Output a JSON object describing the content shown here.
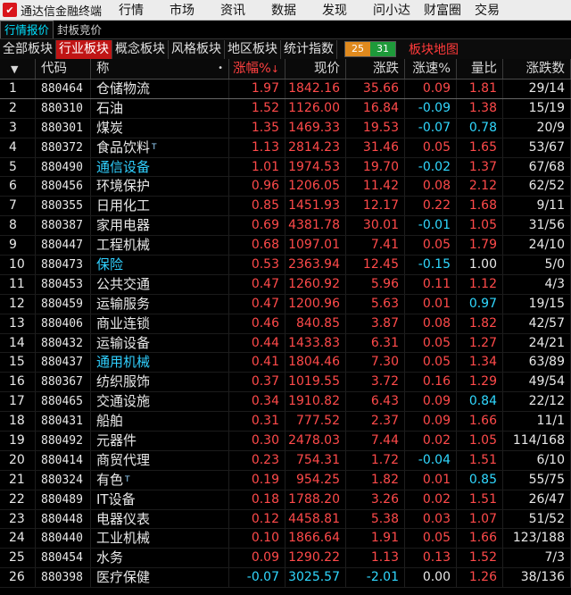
{
  "app": {
    "title": "通达信金融终端",
    "logo_glyph": "✔"
  },
  "menu": [
    "行情",
    "市场",
    "资讯",
    "数据",
    "发现",
    "问小达",
    "财富圈",
    "交易"
  ],
  "subtabs": [
    {
      "label": "行情报价",
      "active": true
    },
    {
      "label": "封板竞价",
      "active": false
    }
  ],
  "board_tabs": [
    {
      "label": "全部板块",
      "active": false
    },
    {
      "label": "行业板块",
      "active": true
    },
    {
      "label": "概念板块",
      "active": false
    },
    {
      "label": "风格板块",
      "active": false
    },
    {
      "label": "地区板块",
      "active": false
    },
    {
      "label": "统计指数",
      "active": false
    }
  ],
  "advance_decline": {
    "up": "25",
    "down": "31"
  },
  "map_link": "板块地图",
  "columns": {
    "code": "代码",
    "name": "称",
    "rise_pct": "涨幅%",
    "price": "现价",
    "change": "涨跌",
    "speed": "涨速%",
    "vol_ratio": "量比",
    "up_down": "涨跌数"
  },
  "colors": {
    "up": "#ff4a4a",
    "down": "#30d8ff",
    "active_tab": "#c01515",
    "cyan_name": "#30d0ff"
  },
  "rows": [
    {
      "i": "1",
      "code": "880464",
      "name": "仓储物流",
      "tag": "",
      "cyan": false,
      "pct": "1.97",
      "price": "1842.16",
      "chg": "35.66",
      "speed": "0.09",
      "speed_dir": "up",
      "vr": "1.81",
      "vr_dir": "up",
      "ud": "29/14"
    },
    {
      "i": "2",
      "code": "880310",
      "name": "石油",
      "tag": "",
      "cyan": false,
      "pct": "1.52",
      "price": "1126.00",
      "chg": "16.84",
      "speed": "-0.09",
      "speed_dir": "down",
      "vr": "1.38",
      "vr_dir": "up",
      "ud": "15/19"
    },
    {
      "i": "3",
      "code": "880301",
      "name": "煤炭",
      "tag": "",
      "cyan": false,
      "pct": "1.35",
      "price": "1469.33",
      "chg": "19.53",
      "speed": "-0.07",
      "speed_dir": "down",
      "vr": "0.78",
      "vr_dir": "down",
      "ud": "20/9"
    },
    {
      "i": "4",
      "code": "880372",
      "name": "食品饮料",
      "tag": "T",
      "cyan": false,
      "pct": "1.13",
      "price": "2814.23",
      "chg": "31.46",
      "speed": "0.05",
      "speed_dir": "up",
      "vr": "1.65",
      "vr_dir": "up",
      "ud": "53/67"
    },
    {
      "i": "5",
      "code": "880490",
      "name": "通信设备",
      "tag": "",
      "cyan": true,
      "pct": "1.01",
      "price": "1974.53",
      "chg": "19.70",
      "speed": "-0.02",
      "speed_dir": "down",
      "vr": "1.37",
      "vr_dir": "up",
      "ud": "67/68"
    },
    {
      "i": "6",
      "code": "880456",
      "name": "环境保护",
      "tag": "",
      "cyan": false,
      "pct": "0.96",
      "price": "1206.05",
      "chg": "11.42",
      "speed": "0.08",
      "speed_dir": "up",
      "vr": "2.12",
      "vr_dir": "up",
      "ud": "62/52"
    },
    {
      "i": "7",
      "code": "880355",
      "name": "日用化工",
      "tag": "",
      "cyan": false,
      "pct": "0.85",
      "price": "1451.93",
      "chg": "12.17",
      "speed": "0.22",
      "speed_dir": "up",
      "vr": "1.68",
      "vr_dir": "up",
      "ud": "9/11"
    },
    {
      "i": "8",
      "code": "880387",
      "name": "家用电器",
      "tag": "",
      "cyan": false,
      "pct": "0.69",
      "price": "4381.78",
      "chg": "30.01",
      "speed": "-0.01",
      "speed_dir": "down",
      "vr": "1.05",
      "vr_dir": "up",
      "ud": "31/56"
    },
    {
      "i": "9",
      "code": "880447",
      "name": "工程机械",
      "tag": "",
      "cyan": false,
      "pct": "0.68",
      "price": "1097.01",
      "chg": "7.41",
      "speed": "0.05",
      "speed_dir": "up",
      "vr": "1.79",
      "vr_dir": "up",
      "ud": "24/10"
    },
    {
      "i": "10",
      "code": "880473",
      "name": "保险",
      "tag": "",
      "cyan": true,
      "pct": "0.53",
      "price": "2363.94",
      "chg": "12.45",
      "speed": "-0.15",
      "speed_dir": "down",
      "vr": "1.00",
      "vr_dir": "flat",
      "ud": "5/0"
    },
    {
      "i": "11",
      "code": "880453",
      "name": "公共交通",
      "tag": "",
      "cyan": false,
      "pct": "0.47",
      "price": "1260.92",
      "chg": "5.96",
      "speed": "0.11",
      "speed_dir": "up",
      "vr": "1.12",
      "vr_dir": "up",
      "ud": "4/3"
    },
    {
      "i": "12",
      "code": "880459",
      "name": "运输服务",
      "tag": "",
      "cyan": false,
      "pct": "0.47",
      "price": "1200.96",
      "chg": "5.63",
      "speed": "0.01",
      "speed_dir": "up",
      "vr": "0.97",
      "vr_dir": "down",
      "ud": "19/15"
    },
    {
      "i": "13",
      "code": "880406",
      "name": "商业连锁",
      "tag": "",
      "cyan": false,
      "pct": "0.46",
      "price": "840.85",
      "chg": "3.87",
      "speed": "0.08",
      "speed_dir": "up",
      "vr": "1.82",
      "vr_dir": "up",
      "ud": "42/57"
    },
    {
      "i": "14",
      "code": "880432",
      "name": "运输设备",
      "tag": "",
      "cyan": false,
      "pct": "0.44",
      "price": "1433.83",
      "chg": "6.31",
      "speed": "0.05",
      "speed_dir": "up",
      "vr": "1.27",
      "vr_dir": "up",
      "ud": "24/21"
    },
    {
      "i": "15",
      "code": "880437",
      "name": "通用机械",
      "tag": "",
      "cyan": true,
      "pct": "0.41",
      "price": "1804.46",
      "chg": "7.30",
      "speed": "0.05",
      "speed_dir": "up",
      "vr": "1.34",
      "vr_dir": "up",
      "ud": "63/89"
    },
    {
      "i": "16",
      "code": "880367",
      "name": "纺织服饰",
      "tag": "",
      "cyan": false,
      "pct": "0.37",
      "price": "1019.55",
      "chg": "3.72",
      "speed": "0.16",
      "speed_dir": "up",
      "vr": "1.29",
      "vr_dir": "up",
      "ud": "49/54"
    },
    {
      "i": "17",
      "code": "880465",
      "name": "交通设施",
      "tag": "",
      "cyan": false,
      "pct": "0.34",
      "price": "1910.82",
      "chg": "6.43",
      "speed": "0.09",
      "speed_dir": "up",
      "vr": "0.84",
      "vr_dir": "down",
      "ud": "22/12"
    },
    {
      "i": "18",
      "code": "880431",
      "name": "船舶",
      "tag": "",
      "cyan": false,
      "pct": "0.31",
      "price": "777.52",
      "chg": "2.37",
      "speed": "0.09",
      "speed_dir": "up",
      "vr": "1.66",
      "vr_dir": "up",
      "ud": "11/1"
    },
    {
      "i": "19",
      "code": "880492",
      "name": "元器件",
      "tag": "",
      "cyan": false,
      "pct": "0.30",
      "price": "2478.03",
      "chg": "7.44",
      "speed": "0.02",
      "speed_dir": "up",
      "vr": "1.05",
      "vr_dir": "up",
      "ud": "114/168"
    },
    {
      "i": "20",
      "code": "880414",
      "name": "商贸代理",
      "tag": "",
      "cyan": false,
      "pct": "0.23",
      "price": "754.31",
      "chg": "1.72",
      "speed": "-0.04",
      "speed_dir": "down",
      "vr": "1.51",
      "vr_dir": "up",
      "ud": "6/10"
    },
    {
      "i": "21",
      "code": "880324",
      "name": "有色",
      "tag": "T",
      "cyan": false,
      "pct": "0.19",
      "price": "954.25",
      "chg": "1.82",
      "speed": "0.01",
      "speed_dir": "up",
      "vr": "0.85",
      "vr_dir": "down",
      "ud": "55/75"
    },
    {
      "i": "22",
      "code": "880489",
      "name": "IT设备",
      "tag": "",
      "cyan": false,
      "pct": "0.18",
      "price": "1788.20",
      "chg": "3.26",
      "speed": "0.02",
      "speed_dir": "up",
      "vr": "1.51",
      "vr_dir": "up",
      "ud": "26/47"
    },
    {
      "i": "23",
      "code": "880448",
      "name": "电器仪表",
      "tag": "",
      "cyan": false,
      "pct": "0.12",
      "price": "4458.81",
      "chg": "5.38",
      "speed": "0.03",
      "speed_dir": "up",
      "vr": "1.07",
      "vr_dir": "up",
      "ud": "51/52"
    },
    {
      "i": "24",
      "code": "880440",
      "name": "工业机械",
      "tag": "",
      "cyan": false,
      "pct": "0.10",
      "price": "1866.64",
      "chg": "1.91",
      "speed": "0.05",
      "speed_dir": "up",
      "vr": "1.66",
      "vr_dir": "up",
      "ud": "123/188"
    },
    {
      "i": "25",
      "code": "880454",
      "name": "水务",
      "tag": "",
      "cyan": false,
      "pct": "0.09",
      "price": "1290.22",
      "chg": "1.13",
      "speed": "0.13",
      "speed_dir": "up",
      "vr": "1.52",
      "vr_dir": "up",
      "ud": "7/3"
    },
    {
      "i": "26",
      "code": "880398",
      "name": "医疗保健",
      "tag": "",
      "cyan": false,
      "pct": "-0.07",
      "price": "3025.57",
      "chg": "-2.01",
      "speed": "0.00",
      "speed_dir": "flat",
      "vr": "1.26",
      "vr_dir": "up",
      "ud": "38/136"
    }
  ]
}
